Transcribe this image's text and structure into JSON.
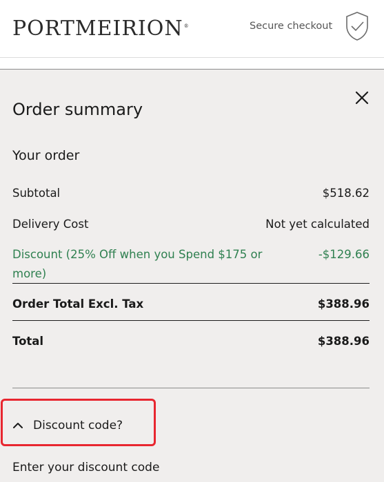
{
  "header": {
    "logo_text": "PORTMEIRION",
    "logo_mark": "®",
    "secure_label": "Secure checkout",
    "secure_icon": "shield-check-icon"
  },
  "summary": {
    "title": "Order summary",
    "close_icon": "close-icon",
    "your_order": "Your order",
    "rows": [
      {
        "label": "Subtotal",
        "value": "$518.62"
      },
      {
        "label": "Delivery Cost",
        "value": "Not yet calculated"
      },
      {
        "label": "Discount (25% Off when you Spend $175 or more)",
        "value": "-$129.66"
      },
      {
        "label": "Order Total Excl. Tax",
        "value": "$388.96"
      },
      {
        "label": "Total",
        "value": "$388.96"
      }
    ],
    "discount_color": "#2f8050"
  },
  "discount_code": {
    "toggle_label": "Discount code?",
    "toggle_icon": "chevron-up-icon",
    "input_label": "Enter your discount code",
    "highlight_color": "#e8262f"
  }
}
